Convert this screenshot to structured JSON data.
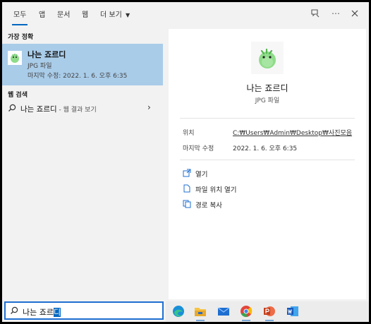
{
  "tabs": [
    {
      "label": "모두",
      "active": true
    },
    {
      "label": "앱",
      "active": false
    },
    {
      "label": "문서",
      "active": false
    },
    {
      "label": "웹",
      "active": false
    },
    {
      "label": "더 보기",
      "active": false
    }
  ],
  "best_match": {
    "section_title": "가장 정확",
    "name": "나는 죠르디",
    "type": "JPG 파일",
    "date": "마지막 수정: 2022. 1. 6. 오후 6:35"
  },
  "web_search": {
    "section_title": "웹 검색",
    "query": "나는 죠르디",
    "hint": " - 웹 결과 보기"
  },
  "preview": {
    "name": "나는 죠르디",
    "type": "JPG 파일",
    "location_label": "위치",
    "location_value": "C:₩Users₩Admin₩Desktop₩사진모음",
    "modified_label": "마지막 수정",
    "modified_value": "2022. 1. 6. 오후 6:35",
    "actions": [
      {
        "label": "열기",
        "icon": "open-icon"
      },
      {
        "label": "파일 위치 열기",
        "icon": "file-location-icon"
      },
      {
        "label": "경로 복사",
        "icon": "copy-icon"
      }
    ]
  },
  "search": {
    "typed": "나는 죠르",
    "selected": "디"
  },
  "taskbar": [
    "edge-icon",
    "file-explorer-icon",
    "mail-icon",
    "chrome-icon",
    "powerpoint-icon",
    "word-icon"
  ],
  "colors": {
    "accent": "#0067c0",
    "selection": "#a9cce9"
  }
}
